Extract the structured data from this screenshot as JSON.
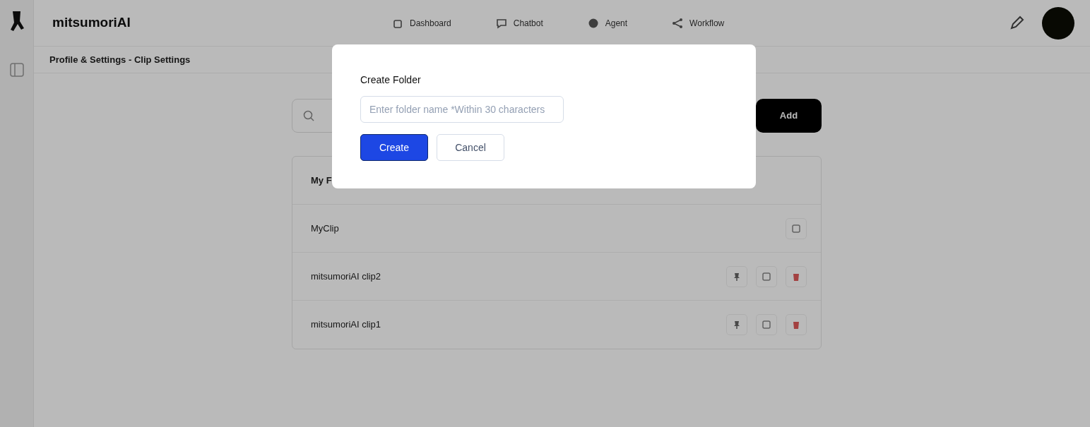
{
  "app": {
    "brand": "mitsumoriAI",
    "nav": [
      {
        "label": "Dashboard"
      },
      {
        "label": "Chatbot"
      },
      {
        "label": "Agent"
      },
      {
        "label": "Workflow"
      }
    ],
    "breadcrumb": "Profile & Settings - Clip Settings"
  },
  "add_button": "Add",
  "folders": [
    {
      "name": "My F",
      "kind": "header"
    },
    {
      "name": "MyClip",
      "kind": "default"
    },
    {
      "name": "mitsumoriAI clip2",
      "kind": "clip"
    },
    {
      "name": "mitsumoriAI clip1",
      "kind": "clip"
    }
  ],
  "dialog": {
    "title": "Create Folder",
    "field": {
      "placeholder": "Enter folder name *Within 30 characters"
    },
    "buttons": [
      {
        "label": "Create",
        "kind": "primary"
      },
      {
        "label": "Cancel",
        "kind": "secondary"
      }
    ]
  }
}
